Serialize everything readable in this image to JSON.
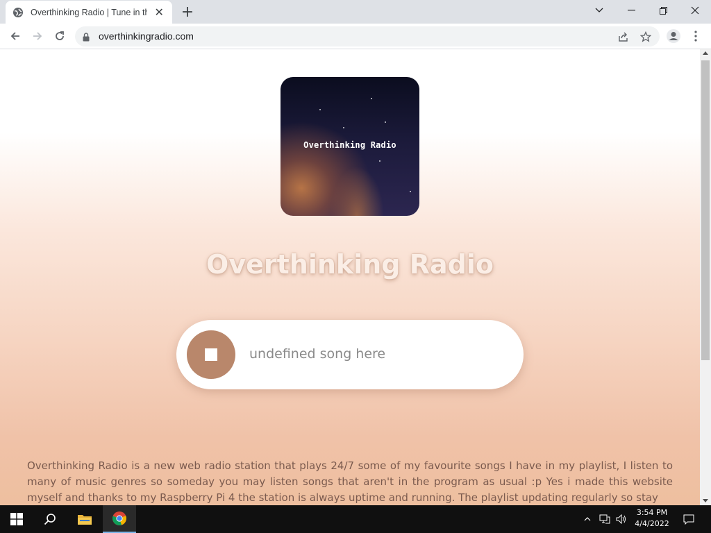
{
  "browser": {
    "tab_title": "Overthinking Radio | Tune in the",
    "url": "overthinkingradio.com"
  },
  "page": {
    "cover_text": "Overthinking Radio",
    "title": "Overthinking Radio",
    "song": "undefined song here",
    "description": "Overthinking Radio is a new web radio station that plays 24/7 some of my favourite songs I have in my playlist, I listen to many of music genres so someday you may listen songs that aren't in the program as usual :p Yes i made this website myself and thanks to my Raspberry Pi 4 the station is always uptime and running. The playlist updating regularly so stay"
  },
  "taskbar": {
    "time": "3:54 PM",
    "date": "4/4/2022"
  },
  "colors": {
    "player_button": "#b9876b",
    "title_text": "#fbeee6",
    "description_text": "#7a5a4e"
  },
  "icons": [
    "globe-icon",
    "close-icon",
    "plus-icon",
    "chevron-down-icon",
    "minimize-icon",
    "restore-icon",
    "back-icon",
    "forward-icon",
    "reload-icon",
    "lock-icon",
    "share-icon",
    "star-icon",
    "profile-icon",
    "menu-icon",
    "windows-start-icon",
    "search-icon",
    "file-explorer-icon",
    "chrome-icon",
    "stop-icon",
    "network-icon",
    "volume-icon",
    "notification-icon"
  ]
}
